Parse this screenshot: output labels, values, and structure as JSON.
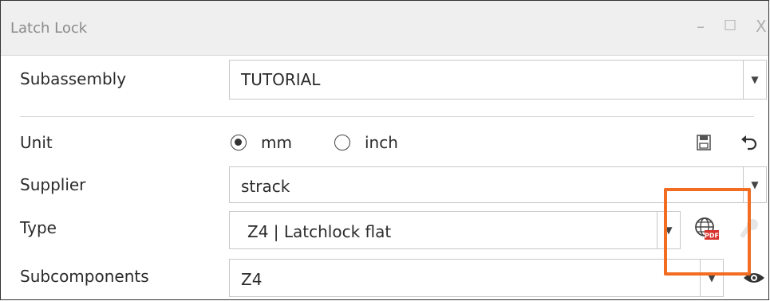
{
  "window": {
    "title": "Latch Lock",
    "minimize": "–",
    "maximize": "☐",
    "close": "X"
  },
  "subassembly": {
    "label": "Subassembly",
    "value": "TUTORIAL",
    "dropdown": "▼"
  },
  "unit": {
    "label": "Unit",
    "options": [
      {
        "label": "mm",
        "selected": true
      },
      {
        "label": "inch",
        "selected": false
      }
    ],
    "save_icon": "save-icon",
    "undo_icon": "undo-icon"
  },
  "supplier": {
    "label": "Supplier",
    "value": "strack",
    "dropdown": "▼"
  },
  "type": {
    "label": "Type",
    "value": "Z4 | Latchlock flat",
    "dropdown": "▼",
    "globe_icon": "globe-pdf-icon",
    "wrench_icon": "wrench-icon"
  },
  "subcomponents": {
    "label": "Subcomponents",
    "value": "Z4",
    "dropdown": "▼",
    "eye_icon": "eye-icon"
  },
  "colors": {
    "highlight": "#f26c21",
    "titlebar": "#efefef"
  }
}
